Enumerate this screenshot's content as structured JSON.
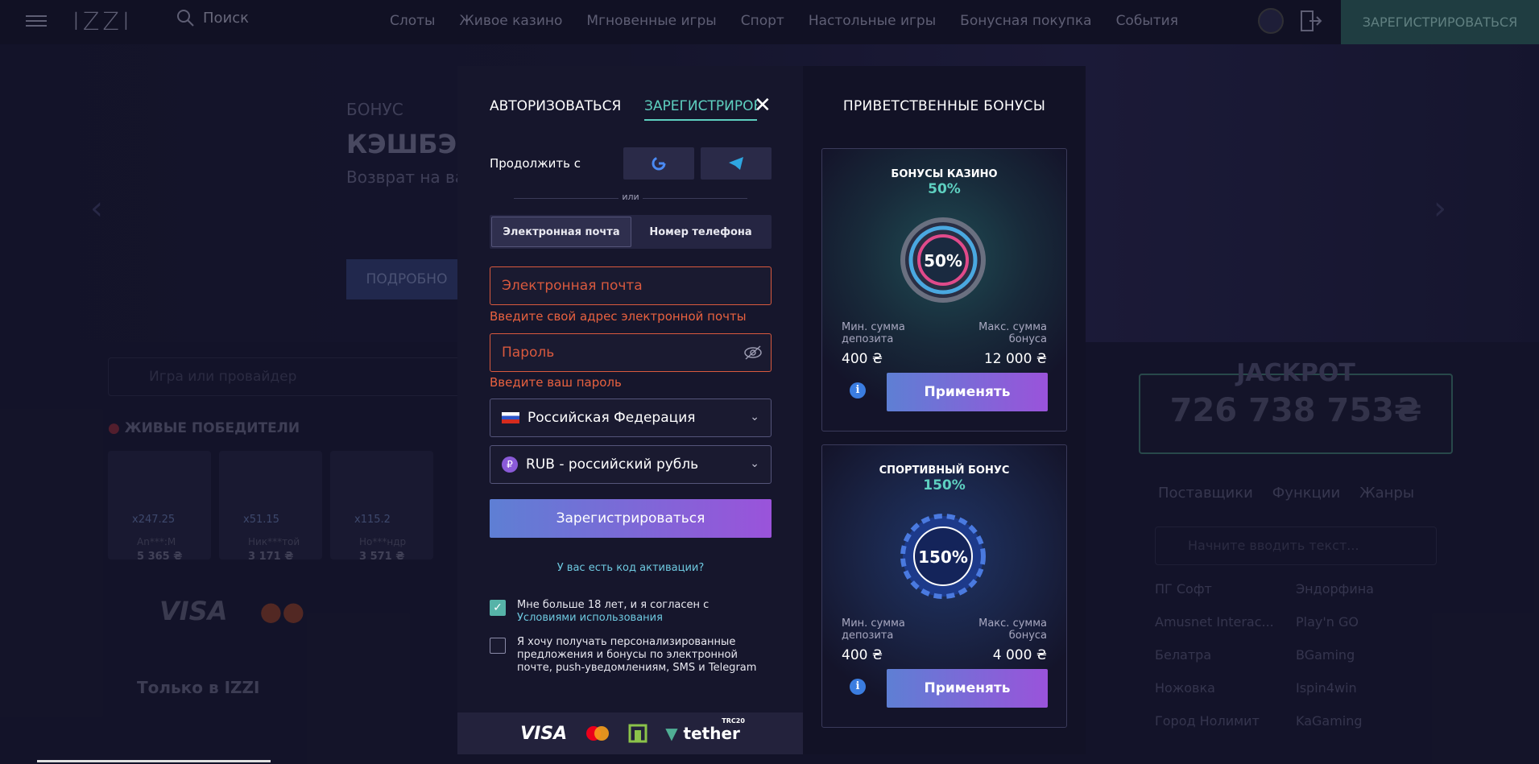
{
  "topbar": {
    "logo": "IZZI",
    "search_label": "Поиск",
    "nav": [
      "Слоты",
      "Живое казино",
      "Мгновенные игры",
      "Спорт",
      "Настольные игры",
      "Бонусная покупка",
      "События"
    ],
    "register_label": "ЗАРЕГИСТРИРОВАТЬСЯ"
  },
  "hero": {
    "small": "БОНУС",
    "big": "КЭШБЭ",
    "sub": "Возврат на ва",
    "button": "ПОДРОБНО"
  },
  "left_panel": {
    "search_placeholder": "Игра или провайдер",
    "live_winners": "ЖИВЫЕ ПОБЕДИТЕЛИ",
    "games": [
      {
        "mult": "x247.25",
        "name": "An***:M",
        "amount": "5 365 ₴"
      },
      {
        "mult": "x51.15",
        "name": "Ник***той",
        "amount": "3 171 ₴"
      },
      {
        "mult": "x115.2",
        "name": "Но***ндр",
        "amount": "3 571 ₴"
      }
    ],
    "only_in": "Только в IZZI"
  },
  "right_panel": {
    "jackpot_title": "JACKPOT",
    "jackpot_value": "726 738 753₴",
    "tabs": [
      "Поставщики",
      "Функции",
      "Жанры"
    ],
    "search_placeholder": "Начните вводить текст...",
    "providers": [
      "ПГ Софт",
      "Эндорфина",
      "Amusnet Interac...",
      "Play'n GO",
      "Белатра",
      "BGaming",
      "Ножовка",
      "Ispin4win",
      "Город Нолимит",
      "KaGaming"
    ]
  },
  "modal": {
    "tab_login": "АВТОРИЗОВАТЬСЯ",
    "tab_register": "ЗАРЕГИСТРИРОВАТЬСЯ",
    "continue_with": "Продолжить с",
    "or": "или",
    "seg_email": "Электронная почта",
    "seg_phone": "Номер телефона",
    "email_placeholder": "Электронная почта",
    "email_error": "Введите свой адрес электронной почты",
    "password_placeholder": "Пароль",
    "password_error": "Введите ваш пароль",
    "country": "Российская Федерация",
    "currency": "RUB - российский рубль",
    "register_button": "Зарегистрироваться",
    "activation_code": "У вас есть код активации?",
    "terms_text": "Мне больше 18 лет, и я согласен с ",
    "terms_link": "Условиями использования",
    "promo_text": "Я хочу получать персонализированные предложения и бонусы по электронной почте, push-уведомлениям, SMS и Telegram",
    "terms_checked": true,
    "promo_checked": false,
    "payments": [
      "VISA",
      "tether"
    ],
    "tether_badge": "TRC20"
  },
  "bonuses": {
    "title": "ПРИВЕТСТВЕННЫЕ БОНУСЫ",
    "cards": [
      {
        "title": "БОНУСЫ КАЗИНО",
        "percent": "50%",
        "chip_text": "50%",
        "min_label": "Мин. сумма депозита",
        "max_label": "Макс. сумма бонуса",
        "min_value": "400 ₴",
        "max_value": "12 000 ₴",
        "apply": "Применять"
      },
      {
        "title": "СПОРТИВНЫЙ БОНУС",
        "percent": "150%",
        "chip_text": "150%",
        "min_label": "Мин. сумма депозита",
        "max_label": "Макс. сумма бонуса",
        "min_value": "400 ₴",
        "max_value": "4 000 ₴",
        "apply": "Применять"
      }
    ]
  },
  "colors": {
    "accent": "#5ed0c0",
    "error": "#e8613f",
    "button_from": "#5e7fd4",
    "button_to": "#9a53da",
    "info": "#3b7de0"
  }
}
